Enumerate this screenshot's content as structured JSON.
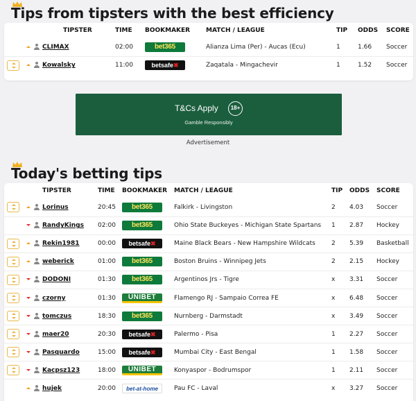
{
  "section1": {
    "title": "Tips from tipsters with the best efficiency",
    "columns": [
      "TIPSTER",
      "TIME",
      "BOOKMAKER",
      "MATCH / LEAGUE",
      "TIP",
      "ODDS",
      "SCORE"
    ],
    "rows": [
      {
        "has_button": false,
        "trend": "up",
        "tipster": "CLIMAX",
        "time": "02:00",
        "bookmaker": "bet365",
        "match": "Alianza Lima (Per) - Aucas (Ecu)",
        "tip": "1",
        "odds": "1.66",
        "sport": "Soccer"
      },
      {
        "has_button": true,
        "trend": "up",
        "tipster": "Kowalsky",
        "time": "11:00",
        "bookmaker": "betsafe",
        "match": "Zaqatala - Mingachevir",
        "tip": "1",
        "odds": "1.52",
        "sport": "Soccer"
      }
    ]
  },
  "ad": {
    "main_text": "T&Cs Apply",
    "age_badge": "18+",
    "sub_text": "Gamble Responsibly",
    "caption": "Advertisement",
    "background_color": "#1b5e3e"
  },
  "section2": {
    "title": "Today's betting tips",
    "columns": [
      "TIPSTER",
      "TIME",
      "BOOKMAKER",
      "MATCH / LEAGUE",
      "TIP",
      "ODDS",
      "SCORE"
    ],
    "rows": [
      {
        "has_button": true,
        "trend": "up",
        "tipster": "Lorinus",
        "time": "20:45",
        "bookmaker": "bet365",
        "match": "Falkirk - Livingston",
        "tip": "2",
        "odds": "4.03",
        "sport": "Soccer"
      },
      {
        "has_button": false,
        "trend": "down",
        "tipster": "RandyKings",
        "time": "02:00",
        "bookmaker": "bet365",
        "match": "Ohio State Buckeyes - Michigan State Spartans",
        "tip": "1",
        "odds": "2.87",
        "sport": "Hockey"
      },
      {
        "has_button": true,
        "trend": "up",
        "tipster": "Rekin1981",
        "time": "00:00",
        "bookmaker": "betsafe",
        "match": "Maine Black Bears - New Hampshire Wildcats",
        "tip": "2",
        "odds": "5.39",
        "sport": "Basketball"
      },
      {
        "has_button": true,
        "trend": "up",
        "tipster": "weberick",
        "time": "01:00",
        "bookmaker": "bet365",
        "match": "Boston Bruins - Winnipeg Jets",
        "tip": "2",
        "odds": "2.15",
        "sport": "Hockey"
      },
      {
        "has_button": true,
        "trend": "down",
        "tipster": "DODONI",
        "time": "01:30",
        "bookmaker": "bet365",
        "match": "Argentinos Jrs - Tigre",
        "tip": "x",
        "odds": "3.31",
        "sport": "Soccer"
      },
      {
        "has_button": true,
        "trend": "down",
        "tipster": "czorny",
        "time": "01:30",
        "bookmaker": "unibet",
        "match": "Flamengo RJ - Sampaio Correa FE",
        "tip": "x",
        "odds": "6.48",
        "sport": "Soccer"
      },
      {
        "has_button": true,
        "trend": "down",
        "tipster": "tomczus",
        "time": "18:30",
        "bookmaker": "bet365",
        "match": "Nurnberg - Darmstadt",
        "tip": "x",
        "odds": "3.49",
        "sport": "Soccer"
      },
      {
        "has_button": true,
        "trend": "down",
        "tipster": "maer20",
        "time": "20:30",
        "bookmaker": "betsafe",
        "match": "Palermo - Pisa",
        "tip": "1",
        "odds": "2.27",
        "sport": "Soccer"
      },
      {
        "has_button": true,
        "trend": "down",
        "tipster": "Pasquardo",
        "time": "15:00",
        "bookmaker": "betsafe",
        "match": "Mumbai City - East Bengal",
        "tip": "1",
        "odds": "1.58",
        "sport": "Soccer"
      },
      {
        "has_button": true,
        "trend": "down",
        "tipster": "Kacpsz123",
        "time": "18:00",
        "bookmaker": "unibet",
        "match": "Konyaspor - Bodrumspor",
        "tip": "1",
        "odds": "2.11",
        "sport": "Soccer"
      },
      {
        "has_button": false,
        "trend": "up",
        "tipster": "hujek",
        "time": "20:00",
        "bookmaker": "bet-at-home",
        "match": "Pau FC - Laval",
        "tip": "x",
        "odds": "3.27",
        "sport": "Soccer"
      }
    ]
  },
  "bookmaker_logos": {
    "bet365": "bet365",
    "betsafe": "betsafe",
    "unibet": "UNIBET",
    "bet-at-home": "bet-at-home"
  },
  "colors": {
    "accent_gold": "#f0b020",
    "trend_up": "#f0a020",
    "trend_down": "#e03030",
    "bet365_green": "#0e7a3b",
    "bet365_yellow": "#ffe35a",
    "unibet_green": "#1d7d3a"
  }
}
